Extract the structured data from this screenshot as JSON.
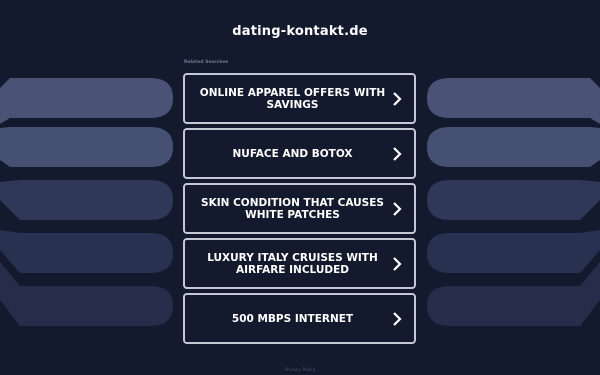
{
  "domain": "dating-kontakt.de",
  "related_label": "Related Searches",
  "links": [
    {
      "label": "ONLINE APPAREL OFFERS WITH SAVINGS"
    },
    {
      "label": "NUFACE AND BOTOX"
    },
    {
      "label": "SKIN CONDITION THAT CAUSES WHITE PATCHES"
    },
    {
      "label": "LUXURY ITALY CRUISES WITH AIRFARE INCLUDED"
    },
    {
      "label": "500 MBPS INTERNET"
    }
  ],
  "footer_text": "Privacy Policy",
  "colors": {
    "background": "#141a2e",
    "link_border": "#c3c8d4",
    "text": "#ffffff"
  }
}
